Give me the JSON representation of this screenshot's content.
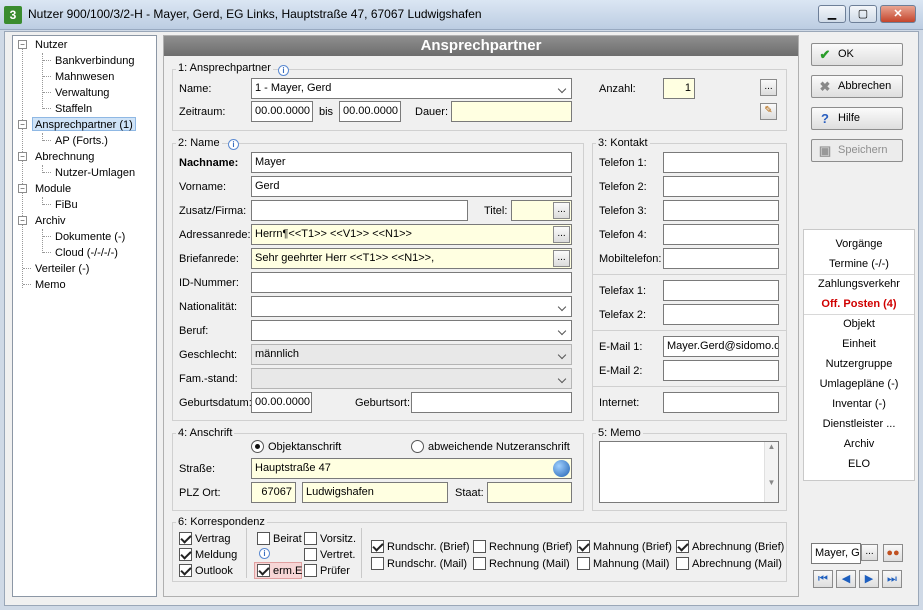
{
  "window": {
    "title": "Nutzer 900/100/3/2-H - Mayer, Gerd, EG Links, Hauptstraße 47, 67067 Ludwigshafen"
  },
  "tree": [
    {
      "label": "Nutzer",
      "level": 0,
      "expander": "-"
    },
    {
      "label": "Bankverbindung",
      "level": 1
    },
    {
      "label": "Mahnwesen",
      "level": 1
    },
    {
      "label": "Verwaltung",
      "level": 1
    },
    {
      "label": "Staffeln",
      "level": 1
    },
    {
      "label": "Ansprechpartner (1)",
      "level": 0,
      "expander": "-",
      "selected": true
    },
    {
      "label": "AP (Forts.)",
      "level": 1
    },
    {
      "label": "Abrechnung",
      "level": 0,
      "expander": "-"
    },
    {
      "label": "Nutzer-Umlagen",
      "level": 1
    },
    {
      "label": "Module",
      "level": 0,
      "expander": "-"
    },
    {
      "label": "FiBu",
      "level": 1
    },
    {
      "label": "Archiv",
      "level": 0,
      "expander": "-"
    },
    {
      "label": "Dokumente (-)",
      "level": 1
    },
    {
      "label": "Cloud (-/-/-/-)",
      "level": 1
    },
    {
      "label": "Verteiler (-)",
      "level": 0
    },
    {
      "label": "Memo",
      "level": 0
    }
  ],
  "header": {
    "title": "Ansprechpartner"
  },
  "ap": {
    "group_title": "1: Ansprechpartner",
    "name_label": "Name:",
    "name_value": "1 - Mayer, Gerd",
    "zeitraum_label": "Zeitraum:",
    "from": "00.00.0000",
    "bis_label": "bis",
    "to": "00.00.0000",
    "dauer_label": "Dauer:",
    "dauer_value": "",
    "anzahl_label": "Anzahl:",
    "anzahl_value": "1",
    "dots": "..."
  },
  "name": {
    "group_title": "2: Name",
    "nachname_label": "Nachname:",
    "nachname": "Mayer",
    "vorname_label": "Vorname:",
    "vorname": "Gerd",
    "zusatz_label": "Zusatz/Firma:",
    "zusatz": "",
    "titel_label": "Titel:",
    "titel": "",
    "adressanrede_label": "Adressanrede:",
    "adressanrede": "Herrn¶<<T1>> <<V1>> <<N1>>",
    "briefanrede_label": "Briefanrede:",
    "briefanrede": "Sehr geehrter Herr <<T1>> <<N1>>,",
    "id_label": "ID-Nummer:",
    "id": "",
    "nationalitaet_label": "Nationalität:",
    "nationalitaet": "",
    "beruf_label": "Beruf:",
    "beruf": "",
    "geschlecht_label": "Geschlecht:",
    "geschlecht": "männlich",
    "famstand_label": "Fam.-stand:",
    "famstand": "",
    "geburtsdatum_label": "Geburtsdatum:",
    "geburtsdatum": "00.00.0000",
    "geburtsort_label": "Geburtsort:",
    "geburtsort": ""
  },
  "kontakt": {
    "group_title": "3: Kontakt",
    "telefon1_label": "Telefon 1:",
    "telefon1": "",
    "telefon2_label": "Telefon 2:",
    "telefon2": "",
    "telefon3_label": "Telefon 3:",
    "telefon3": "",
    "telefon4_label": "Telefon 4:",
    "telefon4": "",
    "mobil_label": "Mobiltelefon:",
    "mobil": "",
    "fax1_label": "Telefax 1:",
    "fax1": "",
    "fax2_label": "Telefax 2:",
    "fax2": "",
    "email1_label": "E-Mail 1:",
    "email1": "Mayer.Gerd@sidomo.de",
    "email2_label": "E-Mail 2:",
    "email2": "",
    "internet_label": "Internet:",
    "internet": ""
  },
  "anschrift": {
    "group_title": "4: Anschrift",
    "radio_objekt": "Objektanschrift",
    "radio_abw": "abweichende Nutzeranschrift",
    "strasse_label": "Straße:",
    "strasse": "Hauptstraße 47",
    "plz_label": "PLZ Ort:",
    "plz": "67067",
    "ort": "Ludwigshafen",
    "staat_label": "Staat:",
    "staat": ""
  },
  "memo": {
    "group_title": "5: Memo",
    "text": ""
  },
  "korrespondenz": {
    "group_title": "6: Korrespondenz",
    "vertrag": "Vertrag",
    "meldung": "Meldung",
    "outlook": "Outlook",
    "beirat": "Beirat",
    "erm": "erm.E",
    "vorsitz": "Vorsitz.",
    "vertret": "Vertret.",
    "pruefer": "Prüfer",
    "rs_brief": "Rundschr. (Brief)",
    "rs_mail": "Rundschr. (Mail)",
    "re_brief": "Rechnung (Brief)",
    "re_mail": "Rechnung (Mail)",
    "ma_brief": "Mahnung (Brief)",
    "ma_mail": "Mahnung (Mail)",
    "ab_brief": "Abrechnung (Brief)",
    "ab_mail": "Abrechnung (Mail)"
  },
  "buttons": {
    "ok": "OK",
    "abbrechen": "Abbrechen",
    "hilfe": "Hilfe",
    "speichern": "Speichern"
  },
  "nav": [
    {
      "label": "Vorgänge"
    },
    {
      "label": "Termine (-/-)"
    },
    {
      "label": "Zahlungsverkehr"
    },
    {
      "label": "Off. Posten (4)",
      "red": true
    },
    {
      "label": "Objekt"
    },
    {
      "label": "Einheit"
    },
    {
      "label": "Nutzergruppe"
    },
    {
      "label": "Umlagepläne (-)"
    },
    {
      "label": "Inventar (-)"
    },
    {
      "label": "Dienstleister ..."
    },
    {
      "label": "Archiv"
    },
    {
      "label": "ELO"
    }
  ],
  "footer": {
    "person": "Mayer, G",
    "dots": "..."
  },
  "colors": {
    "accent_red": "#d00000",
    "field_yellow": "#ffffe1",
    "header_gray": "#7a7a7a"
  }
}
